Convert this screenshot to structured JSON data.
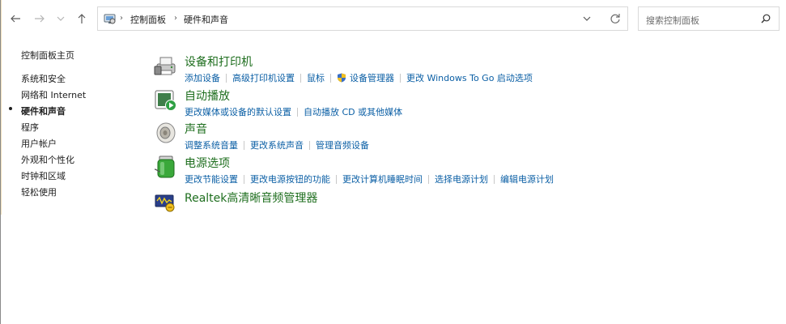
{
  "address": {
    "breadcrumbs": [
      "控制面板",
      "硬件和声音"
    ]
  },
  "search": {
    "placeholder": "搜索控制面板"
  },
  "left_nav": {
    "items": [
      {
        "label": "控制面板主页",
        "current": false
      },
      {
        "label": "系统和安全",
        "current": false
      },
      {
        "label": "网络和 Internet",
        "current": false
      },
      {
        "label": "硬件和声音",
        "current": true
      },
      {
        "label": "程序",
        "current": false
      },
      {
        "label": "用户帐户",
        "current": false
      },
      {
        "label": "外观和个性化",
        "current": false
      },
      {
        "label": "时钟和区域",
        "current": false
      },
      {
        "label": "轻松使用",
        "current": false
      }
    ]
  },
  "categories": [
    {
      "title": "设备和打印机",
      "icon": "printer-icon",
      "links": [
        "添加设备",
        "高级打印机设置",
        "鼠标",
        "设备管理器",
        "更改 Windows To Go 启动选项"
      ]
    },
    {
      "title": "自动播放",
      "icon": "autoplay-icon",
      "links": [
        "更改媒体或设备的默认设置",
        "自动播放 CD 或其他媒体"
      ]
    },
    {
      "title": "声音",
      "icon": "speaker-icon",
      "links": [
        "调整系统音量",
        "更改系统声音",
        "管理音频设备"
      ]
    },
    {
      "title": "电源选项",
      "icon": "battery-icon",
      "links": [
        "更改节能设置",
        "更改电源按钮的功能",
        "更改计算机睡眠时间",
        "选择电源计划",
        "编辑电源计划"
      ]
    },
    {
      "title": "Realtek高清晰音频管理器",
      "icon": "realtek-audio-icon",
      "links": []
    }
  ],
  "colors": {
    "title_green": "#1e6e1e",
    "link_blue": "#0b5fa5"
  }
}
